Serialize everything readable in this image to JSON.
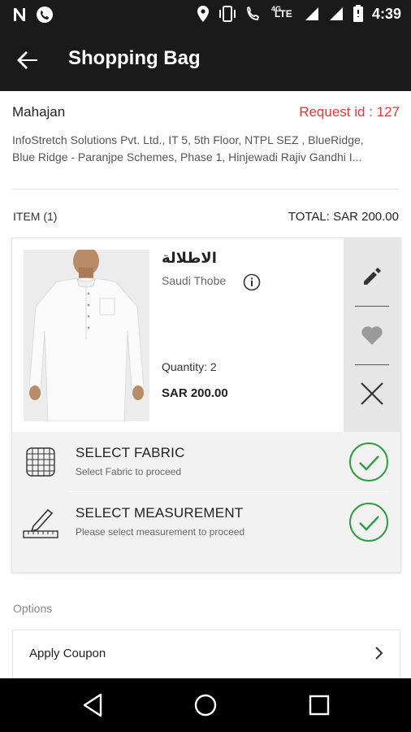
{
  "status_bar": {
    "time": "4:39",
    "network_label": "4G",
    "lte_label": "LTE",
    "icons": [
      "n-notification-icon",
      "phone-notification-icon",
      "location-icon",
      "vibrate-icon",
      "volte-call-icon",
      "signal-icon",
      "signal-icon-2",
      "battery-icon"
    ]
  },
  "app_bar": {
    "title": "Shopping Bag",
    "back_icon": "back-arrow-icon"
  },
  "customer": {
    "name": "Mahajan",
    "request_id": "Request id : 127",
    "address_line1": "InfoStretch Solutions Pvt. Ltd., IT 5, 5th Floor, NTPL SEZ , BlueRidge,",
    "address_line2": "Blue Ridge - Paranjpe Schemes, Phase 1, Hinjewadi Rajiv Gandhi I..."
  },
  "summary": {
    "items_label": "ITEM (1)",
    "total_label": "TOTAL: SAR 200.00"
  },
  "item": {
    "arabic_name": "الاطلالة",
    "subtitle": "Saudi Thobe",
    "quantity": "Quantity: 2",
    "price": "SAR 200.00",
    "image": "white-thobe-photo",
    "actions": [
      "edit-icon",
      "heart-icon",
      "close-icon"
    ]
  },
  "steps": [
    {
      "title": "SELECT FABRIC",
      "subtitle": "Select Fabric to proceed",
      "icon": "fabric-icon",
      "done": true
    },
    {
      "title": "SELECT MEASUREMENT",
      "subtitle": "Please select measurement to proceed",
      "icon": "measurement-icon",
      "done": true
    }
  ],
  "options": {
    "label": "Options",
    "coupon_label": "Apply Coupon"
  },
  "colors": {
    "dark_bar": "#1a1a1a",
    "request_red": "#e53935",
    "check_green": "#2e9e3f"
  },
  "nav_bar": {
    "icons": [
      "back-nav-icon",
      "home-nav-icon",
      "recents-nav-icon"
    ]
  }
}
